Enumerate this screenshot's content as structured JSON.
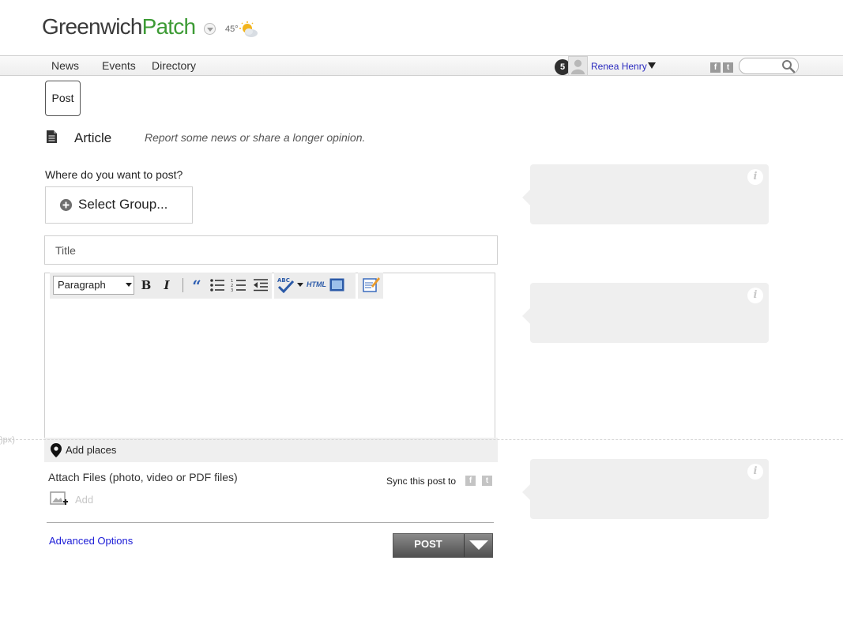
{
  "header": {
    "logo_part1": "Greenwich",
    "logo_part2": "Patch",
    "temperature": "45°",
    "weather_icon": "partly-cloudy-icon",
    "colors": {
      "logo_green": "#3d9b35",
      "logo_gray": "#3a3a3a"
    }
  },
  "nav": {
    "items": [
      {
        "label": "News"
      },
      {
        "label": "Events"
      },
      {
        "label": "Directory"
      }
    ],
    "notification_count": "5",
    "user_name": "Renea Henry",
    "social": [
      "facebook-icon",
      "twitter-icon"
    ],
    "search_placeholder": ""
  },
  "post_tab": {
    "label": "Post"
  },
  "post_type": {
    "icon": "document-icon",
    "label": "Article",
    "description": "Report some news or share a longer opinion."
  },
  "where": {
    "label": "Where do you want to post?",
    "select_label": "Select Group..."
  },
  "title_field": {
    "placeholder": "Title"
  },
  "editor": {
    "format": "Paragraph",
    "tools": [
      "bold",
      "italic",
      "blockquote",
      "bullet-list",
      "numbered-list",
      "outdent",
      "spellcheck",
      "html",
      "media",
      "edit"
    ],
    "html_label": "HTML"
  },
  "places": {
    "label": "Add places"
  },
  "dashed_label": ")px)",
  "attach": {
    "label": "Attach Files (photo, video or PDF files)",
    "add_label": "Add"
  },
  "sync": {
    "label": "Sync this post to",
    "targets": [
      "facebook-icon",
      "twitter-icon"
    ]
  },
  "advanced_link": "Advanced Options",
  "post_button": {
    "label": "POST"
  },
  "tips": [
    {
      "icon": "info-icon",
      "glyph": "i"
    },
    {
      "icon": "info-icon",
      "glyph": "i"
    },
    {
      "icon": "info-icon",
      "glyph": "i"
    }
  ]
}
